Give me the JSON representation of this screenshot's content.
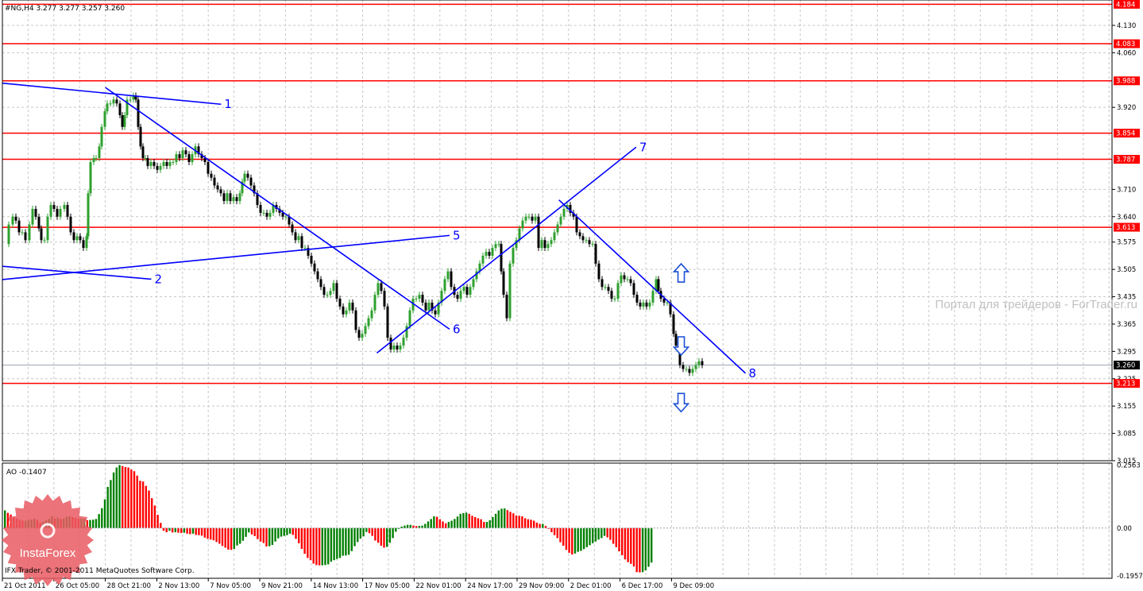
{
  "header": {
    "text": "#NG,H4  3.277 3.277 3.257 3.260"
  },
  "watermark": {
    "text": "Портал для трейдеров - ForTrader.ru"
  },
  "logo": {
    "text": "InstaForex"
  },
  "copyright": {
    "text": "IFX Trader, © 2001-2011 MetaQuotes Software Corp."
  },
  "oscillator": {
    "label": "AO -0.1407"
  },
  "colors": {
    "background": "#ffffff",
    "grid": "#c8c8c8",
    "axis": "#000000",
    "level_line": "#ff0000",
    "trend_line": "#0000ff",
    "arrow": "#1a4fd6",
    "candle_up": "#2ea02e",
    "candle_down": "#000000",
    "ao_up": "#008000",
    "ao_down": "#ff0000",
    "watermark": "#c0c0c0",
    "logo_badge": "#e85a62"
  },
  "chart_data": {
    "type": "candlestick",
    "symbol": "#NG",
    "timeframe": "H4",
    "ohlc_last": {
      "open": 3.277,
      "high": 3.277,
      "low": 3.257,
      "close": 3.26
    },
    "price_axis": {
      "ticks": [
        "4.130",
        "4.060",
        "3.920",
        "3.710",
        "3.640",
        "3.575",
        "3.505",
        "3.435",
        "3.365",
        "3.295",
        "3.225",
        "3.155",
        "3.085",
        "3.015"
      ],
      "ylim": [
        3.015,
        4.195
      ]
    },
    "x_axis": {
      "ticks": [
        "21 Oct 2011",
        "26 Oct 05:00",
        "28 Oct 21:00",
        "2 Nov 13:00",
        "7 Nov 05:00",
        "9 Nov 21:00",
        "14 Nov 13:00",
        "17 Nov 05:00",
        "22 Nov 01:00",
        "24 Nov 17:00",
        "29 Nov 09:00",
        "2 Dec 01:00",
        "6 Dec 17:00",
        "9 Dec 09:00"
      ]
    },
    "horizontal_levels": [
      "4.184",
      "4.083",
      "3.988",
      "3.854",
      "3.787",
      "3.613",
      "3.213"
    ],
    "current_price": "3.260",
    "trend_lines": [
      {
        "label": "1",
        "from": [
          "21 Oct 2011",
          3.982
        ],
        "to": [
          "7 Nov 21:00",
          3.928
        ]
      },
      {
        "label": "2",
        "from": [
          "21 Oct 2011",
          3.513
        ],
        "to": [
          "2 Nov 01:00",
          3.48
        ]
      },
      {
        "label": "5",
        "from": [
          "21 Oct 2011",
          3.479
        ],
        "to": [
          "23 Nov 21:00",
          3.592
        ]
      },
      {
        "label": "6",
        "from": [
          "28 Oct 21:00",
          3.971
        ],
        "to": [
          "23 Nov 21:00",
          3.352
        ]
      },
      {
        "label": "7",
        "from": [
          "18 Nov 13:00",
          3.291
        ],
        "to": [
          "7 Dec 13:00",
          3.818
        ]
      },
      {
        "label": "8",
        "from": [
          "1 Dec 13:00",
          3.683
        ],
        "to": [
          "13 Dec 05:00",
          3.239
        ]
      }
    ],
    "arrows": [
      {
        "direction": "up",
        "date": "9 Dec 21:00",
        "price": 3.495
      },
      {
        "direction": "down",
        "date": "9 Dec 21:00",
        "price": 3.31
      },
      {
        "direction": "down",
        "date": "9 Dec 21:00",
        "price": 3.165
      }
    ],
    "path": [
      [
        0,
        3.57
      ],
      [
        5,
        3.62
      ],
      [
        10,
        3.64
      ],
      [
        14,
        3.63
      ],
      [
        18,
        3.6
      ],
      [
        22,
        3.6
      ],
      [
        26,
        3.58
      ],
      [
        31,
        3.62
      ],
      [
        35,
        3.66
      ],
      [
        39,
        3.64
      ],
      [
        43,
        3.61
      ],
      [
        46,
        3.58
      ],
      [
        50,
        3.58
      ],
      [
        54,
        3.64
      ],
      [
        58,
        3.67
      ],
      [
        62,
        3.66
      ],
      [
        66,
        3.64
      ],
      [
        70,
        3.66
      ],
      [
        75,
        3.67
      ],
      [
        79,
        3.64
      ],
      [
        83,
        3.6
      ],
      [
        87,
        3.58
      ],
      [
        91,
        3.59
      ],
      [
        95,
        3.58
      ],
      [
        99,
        3.56
      ],
      [
        103,
        3.59
      ],
      [
        105,
        3.7
      ],
      [
        108,
        3.78
      ],
      [
        112,
        3.79
      ],
      [
        115,
        3.79
      ],
      [
        119,
        3.82
      ],
      [
        122,
        3.87
      ],
      [
        126,
        3.91
      ],
      [
        129,
        3.93
      ],
      [
        133,
        3.93
      ],
      [
        137,
        3.94
      ],
      [
        141,
        3.93
      ],
      [
        145,
        3.9
      ],
      [
        148,
        3.87
      ],
      [
        151,
        3.9
      ],
      [
        154,
        3.94
      ],
      [
        158,
        3.94
      ],
      [
        162,
        3.95
      ],
      [
        165,
        3.94
      ],
      [
        168,
        3.87
      ],
      [
        171,
        3.82
      ],
      [
        174,
        3.79
      ],
      [
        177,
        3.79
      ],
      [
        180,
        3.77
      ],
      [
        184,
        3.78
      ],
      [
        188,
        3.77
      ],
      [
        192,
        3.76
      ],
      [
        196,
        3.77
      ],
      [
        200,
        3.78
      ],
      [
        204,
        3.77
      ],
      [
        208,
        3.78
      ],
      [
        212,
        3.78
      ],
      [
        216,
        3.8
      ],
      [
        220,
        3.79
      ],
      [
        224,
        3.81
      ],
      [
        228,
        3.8
      ],
      [
        232,
        3.78
      ],
      [
        236,
        3.8
      ],
      [
        240,
        3.82
      ],
      [
        244,
        3.8
      ],
      [
        248,
        3.79
      ],
      [
        252,
        3.78
      ],
      [
        256,
        3.75
      ],
      [
        260,
        3.74
      ],
      [
        264,
        3.72
      ],
      [
        268,
        3.71
      ],
      [
        272,
        3.7
      ],
      [
        276,
        3.68
      ],
      [
        280,
        3.7
      ],
      [
        284,
        3.68
      ],
      [
        288,
        3.69
      ],
      [
        292,
        3.68
      ],
      [
        296,
        3.7
      ],
      [
        299,
        3.73
      ],
      [
        302,
        3.75
      ],
      [
        306,
        3.74
      ],
      [
        310,
        3.72
      ],
      [
        314,
        3.7
      ],
      [
        318,
        3.67
      ],
      [
        322,
        3.65
      ],
      [
        326,
        3.65
      ],
      [
        330,
        3.64
      ],
      [
        334,
        3.65
      ],
      [
        338,
        3.67
      ],
      [
        342,
        3.66
      ],
      [
        346,
        3.65
      ],
      [
        350,
        3.64
      ],
      [
        354,
        3.64
      ],
      [
        358,
        3.62
      ],
      [
        362,
        3.6
      ],
      [
        366,
        3.58
      ],
      [
        370,
        3.59
      ],
      [
        374,
        3.56
      ],
      [
        378,
        3.56
      ],
      [
        382,
        3.54
      ],
      [
        386,
        3.52
      ],
      [
        390,
        3.5
      ],
      [
        394,
        3.48
      ],
      [
        398,
        3.46
      ],
      [
        402,
        3.44
      ],
      [
        406,
        3.44
      ],
      [
        410,
        3.45
      ],
      [
        414,
        3.47
      ],
      [
        418,
        3.43
      ],
      [
        422,
        3.41
      ],
      [
        426,
        3.39
      ],
      [
        430,
        3.4
      ],
      [
        434,
        3.42
      ],
      [
        438,
        3.4
      ],
      [
        442,
        3.35
      ],
      [
        446,
        3.33
      ],
      [
        450,
        3.34
      ],
      [
        454,
        3.36
      ],
      [
        458,
        3.38
      ],
      [
        462,
        3.4
      ],
      [
        466,
        3.44
      ],
      [
        470,
        3.47
      ],
      [
        474,
        3.45
      ],
      [
        478,
        3.41
      ],
      [
        482,
        3.33
      ],
      [
        486,
        3.3
      ],
      [
        490,
        3.31
      ],
      [
        494,
        3.3
      ],
      [
        498,
        3.31
      ],
      [
        502,
        3.33
      ],
      [
        506,
        3.36
      ],
      [
        510,
        3.4
      ],
      [
        514,
        3.43
      ],
      [
        518,
        3.43
      ],
      [
        522,
        3.44
      ],
      [
        526,
        3.42
      ],
      [
        530,
        3.4
      ],
      [
        534,
        3.42
      ],
      [
        538,
        3.4
      ],
      [
        542,
        3.39
      ],
      [
        546,
        3.42
      ],
      [
        550,
        3.45
      ],
      [
        554,
        3.48
      ],
      [
        558,
        3.5
      ],
      [
        562,
        3.46
      ],
      [
        566,
        3.44
      ],
      [
        570,
        3.43
      ],
      [
        574,
        3.45
      ],
      [
        578,
        3.46
      ],
      [
        582,
        3.44
      ],
      [
        586,
        3.46
      ],
      [
        590,
        3.48
      ],
      [
        594,
        3.5
      ],
      [
        598,
        3.52
      ],
      [
        602,
        3.54
      ],
      [
        606,
        3.55
      ],
      [
        610,
        3.54
      ],
      [
        614,
        3.56
      ],
      [
        618,
        3.57
      ],
      [
        622,
        3.57
      ],
      [
        625,
        3.5
      ],
      [
        628,
        3.44
      ],
      [
        632,
        3.38
      ],
      [
        636,
        3.52
      ],
      [
        640,
        3.56
      ],
      [
        644,
        3.58
      ],
      [
        648,
        3.61
      ],
      [
        652,
        3.63
      ],
      [
        656,
        3.64
      ],
      [
        660,
        3.64
      ],
      [
        664,
        3.63
      ],
      [
        668,
        3.64
      ],
      [
        672,
        3.56
      ],
      [
        676,
        3.58
      ],
      [
        680,
        3.56
      ],
      [
        684,
        3.57
      ],
      [
        688,
        3.58
      ],
      [
        692,
        3.6
      ],
      [
        696,
        3.62
      ],
      [
        700,
        3.64
      ],
      [
        704,
        3.66
      ],
      [
        708,
        3.67
      ],
      [
        712,
        3.65
      ],
      [
        716,
        3.64
      ],
      [
        720,
        3.6
      ],
      [
        724,
        3.59
      ],
      [
        728,
        3.58
      ],
      [
        732,
        3.58
      ],
      [
        736,
        3.57
      ],
      [
        740,
        3.57
      ],
      [
        744,
        3.52
      ],
      [
        748,
        3.48
      ],
      [
        752,
        3.46
      ],
      [
        756,
        3.46
      ],
      [
        760,
        3.45
      ],
      [
        764,
        3.43
      ],
      [
        768,
        3.43
      ],
      [
        772,
        3.47
      ],
      [
        776,
        3.49
      ],
      [
        780,
        3.48
      ],
      [
        784,
        3.48
      ],
      [
        788,
        3.47
      ],
      [
        792,
        3.44
      ],
      [
        796,
        3.42
      ],
      [
        800,
        3.41
      ],
      [
        804,
        3.42
      ],
      [
        808,
        3.41
      ],
      [
        812,
        3.42
      ],
      [
        816,
        3.45
      ],
      [
        820,
        3.48
      ],
      [
        823,
        3.45
      ],
      [
        826,
        3.43
      ],
      [
        830,
        3.42
      ],
      [
        834,
        3.42
      ],
      [
        838,
        3.39
      ],
      [
        842,
        3.34
      ],
      [
        845,
        3.31
      ],
      [
        848,
        3.3
      ],
      [
        850,
        3.26
      ],
      [
        854,
        3.25
      ],
      [
        858,
        3.25
      ],
      [
        862,
        3.24
      ],
      [
        866,
        3.25
      ],
      [
        870,
        3.26
      ],
      [
        874,
        3.27
      ],
      [
        878,
        3.26
      ]
    ],
    "ao": {
      "label": "AO -0.1407",
      "ticks": [
        "0.2563",
        "0.00",
        "-0.1957"
      ],
      "ylim": [
        -0.205,
        0.265
      ],
      "values": [
        0.072,
        0.062,
        0.055,
        0.043,
        0.039,
        0.034,
        0.03,
        0.03,
        0.033,
        0.035,
        0.038,
        0.033,
        0.022,
        0.025,
        0.031,
        0.037,
        0.048,
        0.039,
        0.042,
        0.037,
        0.039,
        0.046,
        0.048,
        0.045,
        0.041,
        0.038,
        0.038,
        0.038,
        0.032,
        0.033,
        0.034,
        0.037,
        0.057,
        0.081,
        0.117,
        0.168,
        0.196,
        0.227,
        0.247,
        0.257,
        0.253,
        0.249,
        0.247,
        0.239,
        0.232,
        0.214,
        0.193,
        0.19,
        0.172,
        0.153,
        0.122,
        0.092,
        0.054,
        0.021,
        -0.011,
        -0.017,
        -0.011,
        -0.018,
        -0.017,
        -0.019,
        -0.02,
        -0.019,
        -0.023,
        -0.025,
        -0.023,
        -0.028,
        -0.029,
        -0.031,
        -0.039,
        -0.044,
        -0.047,
        -0.05,
        -0.057,
        -0.064,
        -0.073,
        -0.08,
        -0.088,
        -0.089,
        -0.085,
        -0.071,
        -0.064,
        -0.052,
        -0.036,
        -0.018,
        -0.026,
        -0.033,
        -0.045,
        -0.055,
        -0.061,
        -0.075,
        -0.074,
        -0.069,
        -0.055,
        -0.042,
        -0.035,
        -0.032,
        -0.029,
        -0.023,
        -0.028,
        -0.044,
        -0.062,
        -0.085,
        -0.105,
        -0.122,
        -0.131,
        -0.145,
        -0.151,
        -0.152,
        -0.152,
        -0.151,
        -0.148,
        -0.137,
        -0.131,
        -0.126,
        -0.122,
        -0.113,
        -0.112,
        -0.109,
        -0.094,
        -0.074,
        -0.057,
        -0.043,
        -0.034,
        -0.016,
        -0.021,
        -0.032,
        -0.051,
        -0.06,
        -0.072,
        -0.08,
        -0.077,
        -0.06,
        -0.041,
        -0.015,
        0.0,
        0.006,
        0.01,
        0.013,
        0.013,
        0.01,
        0.008,
        0.009,
        0.01,
        0.017,
        0.027,
        0.037,
        0.048,
        0.046,
        0.036,
        0.027,
        0.019,
        0.025,
        0.03,
        0.037,
        0.047,
        0.058,
        0.061,
        0.063,
        0.058,
        0.05,
        0.045,
        0.04,
        0.036,
        0.025,
        0.025,
        0.032,
        0.045,
        0.058,
        0.072,
        0.079,
        0.08,
        0.073,
        0.066,
        0.06,
        0.051,
        0.05,
        0.048,
        0.04,
        0.036,
        0.034,
        0.03,
        0.022,
        0.017,
        0.017,
        0.009,
        -0.003,
        -0.017,
        -0.029,
        -0.041,
        -0.058,
        -0.072,
        -0.089,
        -0.101,
        -0.108,
        -0.104,
        -0.097,
        -0.093,
        -0.086,
        -0.078,
        -0.07,
        -0.062,
        -0.055,
        -0.047,
        -0.041,
        -0.032,
        -0.038,
        -0.048,
        -0.064,
        -0.078,
        -0.095,
        -0.111,
        -0.128,
        -0.139,
        -0.146,
        -0.157,
        -0.18,
        -0.181,
        -0.18,
        -0.173,
        -0.158,
        -0.141
      ]
    }
  }
}
